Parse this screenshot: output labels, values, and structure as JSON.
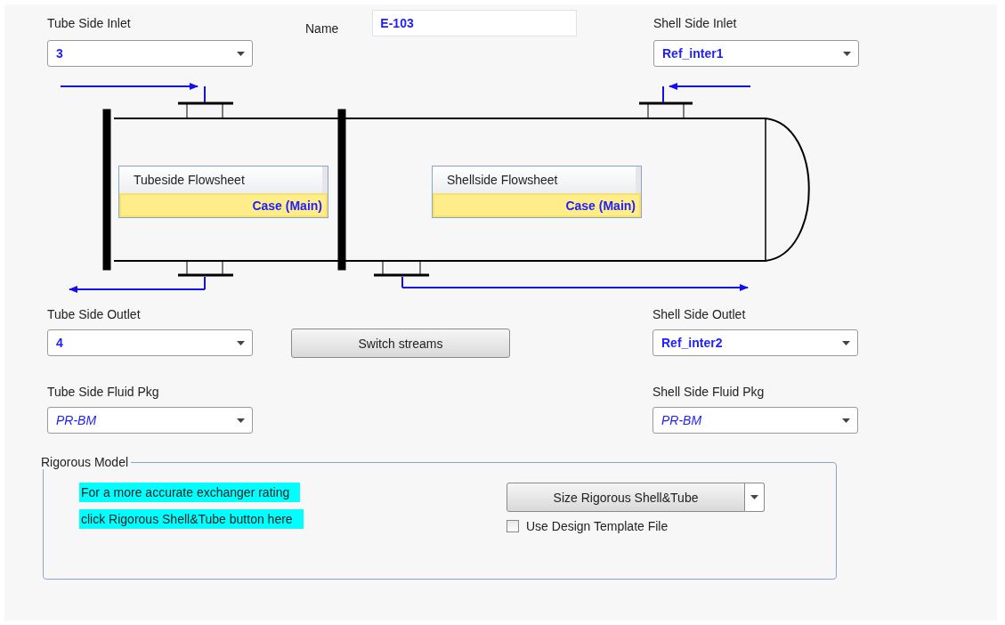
{
  "tube_side_inlet": {
    "label": "Tube Side Inlet",
    "value": "3",
    "kind": "stream"
  },
  "name": {
    "label": "Name",
    "value": "E-103"
  },
  "shell_side_inlet": {
    "label": "Shell Side Inlet",
    "value": "Ref_inter1",
    "kind": "stream"
  },
  "diagram": {
    "flowsheets": [
      {
        "header": "Tubeside Flowsheet",
        "value": "Case (Main)"
      },
      {
        "header": "Shellside Flowsheet",
        "value": "Case (Main)"
      }
    ]
  },
  "tube_side_outlet": {
    "label": "Tube Side Outlet",
    "value": "4",
    "kind": "stream"
  },
  "switch_button": "Switch streams",
  "shell_side_outlet": {
    "label": "Shell Side Outlet",
    "value": "Ref_inter2",
    "kind": "stream"
  },
  "tube_side_fluid_pkg": {
    "label": "Tube Side Fluid Pkg",
    "value": "PR-BM",
    "kind": "package"
  },
  "shell_side_fluid_pkg": {
    "label": "Shell Side Fluid Pkg",
    "value": "PR-BM",
    "kind": "package"
  },
  "rigorous_model": {
    "title": "Rigorous Model",
    "hint_lines": [
      "For a more accurate exchanger rating",
      "click Rigorous Shell&Tube button here"
    ],
    "size_button": "Size Rigorous Shell&Tube",
    "template_checkbox": {
      "label": "Use Design Template File",
      "checked": false
    }
  }
}
